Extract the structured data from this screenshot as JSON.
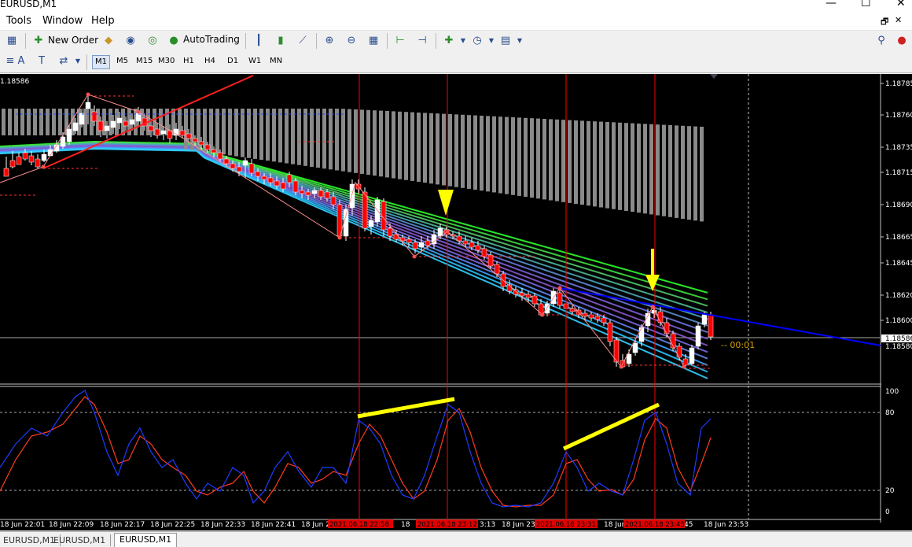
{
  "window": {
    "title": "EURUSD,M1",
    "minimize": "—",
    "maximize": "☐",
    "close": "✕"
  },
  "menu": [
    "Tools",
    "Window",
    "Help"
  ],
  "toolbar": {
    "new_order": "New Order",
    "auto_trading": "AutoTrading"
  },
  "drawing_tools": {
    "text": "A",
    "text_label": "T"
  },
  "timeframes": [
    "M1",
    "M5",
    "M15",
    "M30",
    "H1",
    "H4",
    "D1",
    "W1",
    "MN"
  ],
  "active_timeframe": "M1",
  "chart": {
    "top_left_price": "1.18586",
    "price_labels": [
      "1.18785",
      "1.18760",
      "1.18735",
      "1.18715",
      "1.18690",
      "1.18665",
      "1.18645",
      "1.18620",
      "1.18600"
    ],
    "price_lower": [
      "1.18586",
      "1.18580"
    ],
    "current_price": "1.18586",
    "countdown": "00:01",
    "oscillator_levels": [
      "100",
      "80",
      "20",
      "0"
    ],
    "time_labels": [
      "18 Jun 22:01",
      "18 Jun 22:09",
      "18 Jun 22:17",
      "18 Jun 22:25",
      "18 Jun 22:33",
      "18 Jun 22:41",
      "18 Jun 2",
      "18",
      "3:13",
      "18 Jun 23",
      "18 Jun",
      "45",
      "18 Jun 23:53"
    ],
    "highlight_times": [
      "2021.06.18 22:58",
      "2021.06.18 23:12",
      "2021.06.18 23:31",
      "2021.06.18 23:45"
    ],
    "colors": {
      "bull_candle": "#ffffff",
      "bear_candle": "#ff0000",
      "vline": "#ff0000",
      "trendline": "#0000ff",
      "annotation": "#ffff00",
      "stoch_main": "#1e3cff",
      "stoch_signal": "#ff3b1e"
    }
  },
  "tabs": [
    "EURUSD,M1",
    "EURUSD,M1",
    "EURUSD,M1"
  ],
  "active_tab": 2
}
